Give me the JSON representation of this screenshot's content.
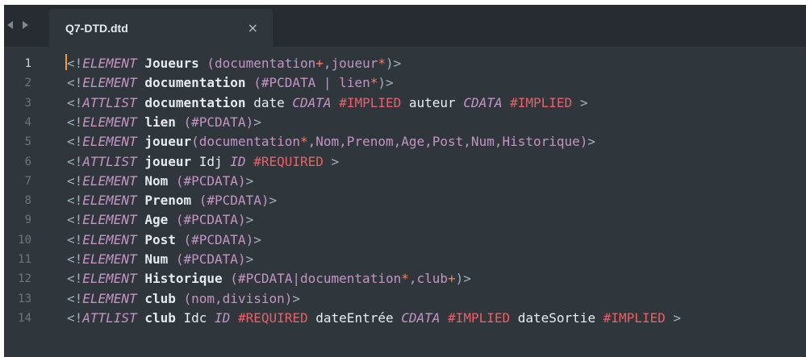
{
  "window": {
    "tab": {
      "title": "Q7-DTD.dtd",
      "close_glyph": "×"
    },
    "nav": {
      "back_icon": "chevron-left-icon",
      "forward_icon": "chevron-right-icon"
    }
  },
  "editor": {
    "active_line": 1,
    "lines": [
      {
        "number": "1",
        "tokens": [
          {
            "t": "<!",
            "c": "punct"
          },
          {
            "t": "ELEMENT",
            "c": "decl"
          },
          {
            "t": " Joueurs ",
            "c": "name"
          },
          {
            "t": "(documentation",
            "c": "content"
          },
          {
            "t": "+",
            "c": "op"
          },
          {
            "t": ",joueur",
            "c": "content"
          },
          {
            "t": "*",
            "c": "op"
          },
          {
            "t": ")>",
            "c": "punct"
          }
        ]
      },
      {
        "number": "2",
        "tokens": [
          {
            "t": "<!",
            "c": "punct"
          },
          {
            "t": "ELEMENT",
            "c": "decl"
          },
          {
            "t": " documentation ",
            "c": "name"
          },
          {
            "t": "(#PCDATA | lien",
            "c": "content"
          },
          {
            "t": "*",
            "c": "op"
          },
          {
            "t": ")>",
            "c": "punct"
          }
        ]
      },
      {
        "number": "3",
        "tokens": [
          {
            "t": "<!",
            "c": "punct"
          },
          {
            "t": "ATTLIST",
            "c": "decl"
          },
          {
            "t": " documentation ",
            "c": "name"
          },
          {
            "t": "date ",
            "c": "attr"
          },
          {
            "t": "CDATA",
            "c": "type"
          },
          {
            "t": " ",
            "c": "attr"
          },
          {
            "t": "#IMPLIED",
            "c": "default"
          },
          {
            "t": " auteur ",
            "c": "attr"
          },
          {
            "t": "CDATA",
            "c": "type"
          },
          {
            "t": " ",
            "c": "attr"
          },
          {
            "t": "#IMPLIED",
            "c": "default"
          },
          {
            "t": " >",
            "c": "punct"
          }
        ]
      },
      {
        "number": "4",
        "tokens": [
          {
            "t": "<!",
            "c": "punct"
          },
          {
            "t": "ELEMENT",
            "c": "decl"
          },
          {
            "t": " lien ",
            "c": "name"
          },
          {
            "t": "(#PCDATA)",
            "c": "content"
          },
          {
            "t": ">",
            "c": "punct"
          }
        ]
      },
      {
        "number": "5",
        "tokens": [
          {
            "t": "<!",
            "c": "punct"
          },
          {
            "t": "ELEMENT",
            "c": "decl"
          },
          {
            "t": " joueur",
            "c": "name"
          },
          {
            "t": "(documentation",
            "c": "content"
          },
          {
            "t": "*",
            "c": "op"
          },
          {
            "t": ",Nom,Prenom,Age,Post,Num,Historique)",
            "c": "content"
          },
          {
            "t": ">",
            "c": "punct"
          }
        ]
      },
      {
        "number": "6",
        "tokens": [
          {
            "t": "<!",
            "c": "punct"
          },
          {
            "t": "ATTLIST",
            "c": "decl"
          },
          {
            "t": " joueur ",
            "c": "name"
          },
          {
            "t": "Idj ",
            "c": "attr"
          },
          {
            "t": "ID",
            "c": "type"
          },
          {
            "t": " ",
            "c": "attr"
          },
          {
            "t": "#REQUIRED",
            "c": "default"
          },
          {
            "t": " >",
            "c": "punct"
          }
        ]
      },
      {
        "number": "7",
        "tokens": [
          {
            "t": "<!",
            "c": "punct"
          },
          {
            "t": "ELEMENT",
            "c": "decl"
          },
          {
            "t": " Nom ",
            "c": "name"
          },
          {
            "t": "(#PCDATA)",
            "c": "content"
          },
          {
            "t": ">",
            "c": "punct"
          }
        ]
      },
      {
        "number": "8",
        "tokens": [
          {
            "t": "<!",
            "c": "punct"
          },
          {
            "t": "ELEMENT",
            "c": "decl"
          },
          {
            "t": " Prenom ",
            "c": "name"
          },
          {
            "t": "(#PCDATA)",
            "c": "content"
          },
          {
            "t": ">",
            "c": "punct"
          }
        ]
      },
      {
        "number": "9",
        "tokens": [
          {
            "t": "<!",
            "c": "punct"
          },
          {
            "t": "ELEMENT",
            "c": "decl"
          },
          {
            "t": " Age ",
            "c": "name"
          },
          {
            "t": "(#PCDATA)",
            "c": "content"
          },
          {
            "t": ">",
            "c": "punct"
          }
        ]
      },
      {
        "number": "10",
        "tokens": [
          {
            "t": "<!",
            "c": "punct"
          },
          {
            "t": "ELEMENT",
            "c": "decl"
          },
          {
            "t": " Post ",
            "c": "name"
          },
          {
            "t": "(#PCDATA)",
            "c": "content"
          },
          {
            "t": ">",
            "c": "punct"
          }
        ]
      },
      {
        "number": "11",
        "tokens": [
          {
            "t": "<!",
            "c": "punct"
          },
          {
            "t": "ELEMENT",
            "c": "decl"
          },
          {
            "t": " Num ",
            "c": "name"
          },
          {
            "t": "(#PCDATA)",
            "c": "content"
          },
          {
            "t": ">",
            "c": "punct"
          }
        ]
      },
      {
        "number": "12",
        "tokens": [
          {
            "t": "<!",
            "c": "punct"
          },
          {
            "t": "ELEMENT",
            "c": "decl"
          },
          {
            "t": " Historique ",
            "c": "name"
          },
          {
            "t": "(#PCDATA|documentation",
            "c": "content"
          },
          {
            "t": "*",
            "c": "op"
          },
          {
            "t": ",club",
            "c": "content"
          },
          {
            "t": "+",
            "c": "op"
          },
          {
            "t": ")>",
            "c": "punct"
          }
        ]
      },
      {
        "number": "13",
        "tokens": [
          {
            "t": "<!",
            "c": "punct"
          },
          {
            "t": "ELEMENT",
            "c": "decl"
          },
          {
            "t": " club ",
            "c": "name"
          },
          {
            "t": "(nom,division)",
            "c": "content"
          },
          {
            "t": ">",
            "c": "punct"
          }
        ]
      },
      {
        "number": "14",
        "tokens": [
          {
            "t": "<!",
            "c": "punct"
          },
          {
            "t": "ATTLIST",
            "c": "decl"
          },
          {
            "t": " club ",
            "c": "name"
          },
          {
            "t": "Idc ",
            "c": "attr"
          },
          {
            "t": "ID",
            "c": "type"
          },
          {
            "t": " ",
            "c": "attr"
          },
          {
            "t": "#REQUIRED",
            "c": "default"
          },
          {
            "t": " dateEntrée ",
            "c": "attr"
          },
          {
            "t": "CDATA",
            "c": "type"
          },
          {
            "t": " ",
            "c": "attr"
          },
          {
            "t": "#IMPLIED",
            "c": "default"
          },
          {
            "t": " dateSortie ",
            "c": "attr"
          },
          {
            "t": "#IMPLIED",
            "c": "default"
          },
          {
            "t": " >",
            "c": "punct"
          }
        ]
      }
    ]
  },
  "colors": {
    "background": "#2f363c",
    "tabbar": "#262c31",
    "punct": "#9fb2bf",
    "decl": "#c594c5",
    "name": "#e6eaee",
    "operator": "#f97b58",
    "default": "#ec5f67",
    "cursor": "#f29b3a"
  }
}
